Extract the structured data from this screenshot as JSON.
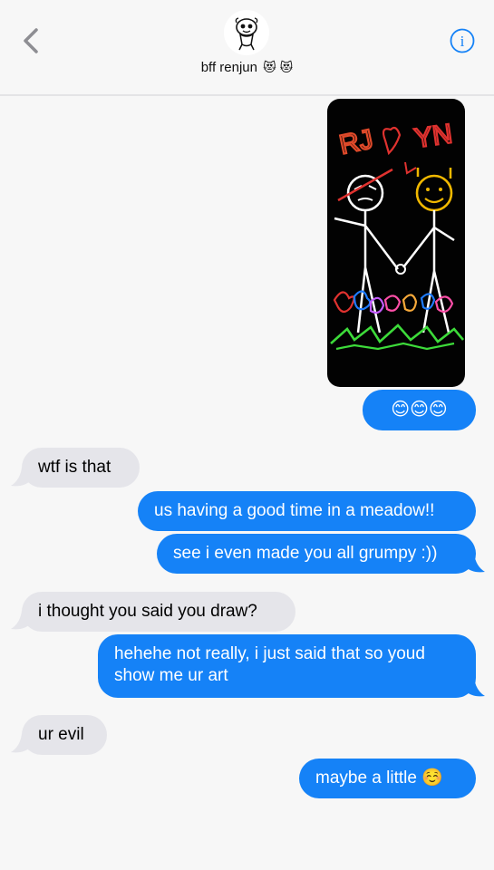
{
  "header": {
    "contact_name": "bff renjun",
    "contact_emoji": "😻 😻",
    "info_label": "i"
  },
  "colors": {
    "sent_bubble": "#1582f7",
    "received_bubble": "#e5e5ea",
    "background": "#f7f7f7",
    "accent": "#1582f7"
  },
  "icons": {
    "back": "chevron-left-icon",
    "info": "info-circle-icon",
    "avatar": "sticker-avatar"
  },
  "photo": {
    "drawing_text_left": "RJ",
    "drawing_text_right": "YN"
  },
  "messages": [
    {
      "from": "me",
      "text": "😊😊😊"
    },
    {
      "from": "them",
      "text": "wtf is that"
    },
    {
      "from": "me",
      "text": "us having a good time in a meadow!!"
    },
    {
      "from": "me",
      "text": "see i even made you all grumpy :))"
    },
    {
      "from": "them",
      "text": "i thought you said you draw?"
    },
    {
      "from": "me",
      "text": "hehehe not really, i just said that so youd show me ur art"
    },
    {
      "from": "them",
      "text": "ur evil"
    },
    {
      "from": "me",
      "text": "maybe a little ☺️"
    }
  ]
}
